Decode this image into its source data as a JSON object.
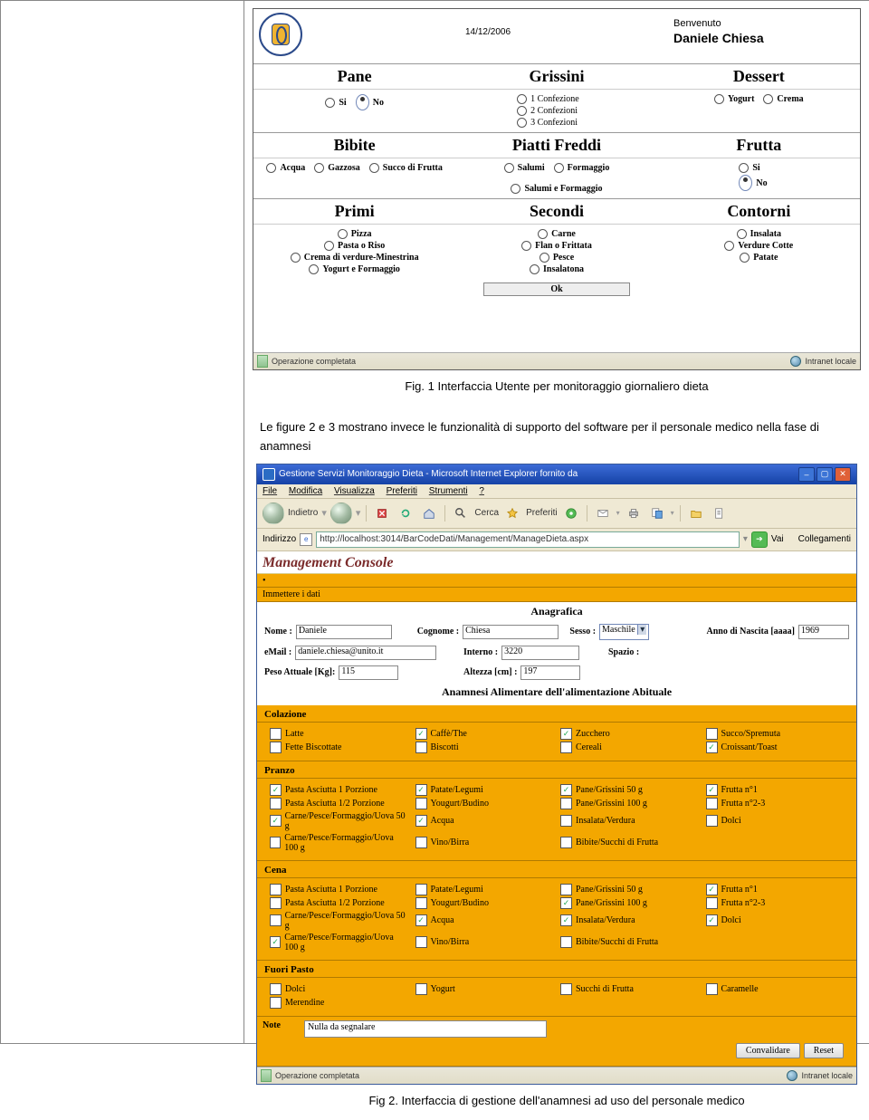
{
  "caption1": "Fig. 1 Interfaccia Utente per monitoraggio giornaliero dieta",
  "body_text": "Le figure 2 e 3 mostrano invece le funzionalità di supporto del software per il personale medico nella fase di anamnesi",
  "caption2": "Fig 2. Interfaccia di gestione dell'anamnesi ad uso del personale medico",
  "fig1": {
    "date": "14/12/2006",
    "welcome": "Benvenuto",
    "user": "Daniele Chiesa",
    "status_left": "Operazione completata",
    "status_right": "Intranet locale",
    "ok": "Ok",
    "sections": {
      "pane": {
        "title": "Pane",
        "opts": [
          "Si",
          "No"
        ],
        "selected": "No",
        "layout": "inline"
      },
      "grissini": {
        "title": "Grissini",
        "opts": [
          "1 Confezione",
          "2 Confezioni",
          "3 Confezioni"
        ],
        "layout": "stack"
      },
      "dessert": {
        "title": "Dessert",
        "opts": [
          "Yogurt",
          "Crema"
        ],
        "layout": "inline"
      },
      "bibite": {
        "title": "Bibite",
        "opts": [
          "Acqua",
          "Gazzosa",
          "Succo di Frutta"
        ],
        "layout": "inline"
      },
      "piatti": {
        "title": "Piatti Freddi",
        "opts": [
          "Salumi",
          "Formaggio",
          "Salumi e Formaggio"
        ],
        "layout": "inline"
      },
      "frutta": {
        "title": "Frutta",
        "opts": [
          "Si",
          "No"
        ],
        "selected": "No",
        "layout": "stack"
      },
      "primi": {
        "title": "Primi",
        "opts": [
          "Pizza",
          "Pasta o Riso",
          "Crema di verdure-Minestrina",
          "Yogurt e Formaggio"
        ],
        "layout": "stack"
      },
      "secondi": {
        "title": "Secondi",
        "opts": [
          "Carne",
          "Flan o Frittata",
          "Pesce",
          "Insalatona"
        ],
        "layout": "stack"
      },
      "contorni": {
        "title": "Contorni",
        "opts": [
          "Insalata",
          "Verdure Cotte",
          "Patate"
        ],
        "layout": "stack"
      }
    }
  },
  "fig2": {
    "window_title": "Gestione Servizi Monitoraggio Dieta - Microsoft Internet Explorer fornito da",
    "menu": [
      "File",
      "Modifica",
      "Visualizza",
      "Preferiti",
      "Strumenti",
      "?"
    ],
    "toolbar": {
      "back": "Indietro",
      "search": "Cerca",
      "fav": "Preferiti"
    },
    "address_label": "Indirizzo",
    "address_value": "http://localhost:3014/BarCodeDati/Management/ManageDieta.aspx",
    "go": "Vai",
    "links": "Collegamenti",
    "mc_title": "Management Console",
    "insert_label": "Immettere i dati",
    "status_left": "Operazione completata",
    "status_right": "Intranet locale",
    "section_anagrafica": "Anagrafica",
    "section_anamnesi": "Anamnesi Alimentare dell'alimentazione Abituale",
    "fields": {
      "nome": {
        "label": "Nome :",
        "value": "Daniele"
      },
      "cognome": {
        "label": "Cognome :",
        "value": "Chiesa"
      },
      "sesso": {
        "label": "Sesso :",
        "value": "Maschile"
      },
      "anno": {
        "label": "Anno di Nascita [aaaa]",
        "value": "1969"
      },
      "email": {
        "label": "eMail :",
        "value": "daniele.chiesa@unito.it"
      },
      "interno": {
        "label": "Interno :",
        "value": "3220"
      },
      "spazio": {
        "label": "Spazio :",
        "value": ""
      },
      "peso": {
        "label": "Peso Attuale [Kg]:",
        "value": "115"
      },
      "altezza": {
        "label": "Altezza [cm] :",
        "value": "197"
      }
    },
    "meals": {
      "colazione": {
        "title": "Colazione",
        "cols": [
          [
            [
              "Latte",
              false
            ],
            [
              "Fette Biscottate",
              false
            ]
          ],
          [
            [
              "Caffè/The",
              true
            ],
            [
              "Biscotti",
              false
            ]
          ],
          [
            [
              "Zucchero",
              true
            ],
            [
              "Cereali",
              false
            ]
          ],
          [
            [
              "Succo/Spremuta",
              false
            ],
            [
              "Croissant/Toast",
              true
            ]
          ]
        ]
      },
      "pranzo": {
        "title": "Pranzo",
        "cols": [
          [
            [
              "Pasta Asciutta 1 Porzione",
              true
            ],
            [
              "Pasta Asciutta 1/2 Porzione",
              false
            ],
            [
              "Carne/Pesce/Formaggio/Uova 50 g",
              true
            ],
            [
              "Carne/Pesce/Formaggio/Uova 100 g",
              false
            ]
          ],
          [
            [
              "Patate/Legumi",
              true
            ],
            [
              "Yougurt/Budino",
              false
            ],
            [
              "Acqua",
              true
            ],
            [
              "Vino/Birra",
              false
            ]
          ],
          [
            [
              "Pane/Grissini 50 g",
              true
            ],
            [
              "Pane/Grissini 100 g",
              false
            ],
            [
              "Insalata/Verdura",
              false
            ],
            [
              "Bibite/Succhi di Frutta",
              false
            ]
          ],
          [
            [
              "Frutta n°1",
              true
            ],
            [
              "Frutta n°2-3",
              false
            ],
            [
              "Dolci",
              false
            ]
          ]
        ]
      },
      "cena": {
        "title": "Cena",
        "cols": [
          [
            [
              "Pasta Asciutta 1 Porzione",
              false
            ],
            [
              "Pasta Asciutta 1/2 Porzione",
              false
            ],
            [
              "Carne/Pesce/Formaggio/Uova 50 g",
              false
            ],
            [
              "Carne/Pesce/Formaggio/Uova 100 g",
              true
            ]
          ],
          [
            [
              "Patate/Legumi",
              false
            ],
            [
              "Yougurt/Budino",
              false
            ],
            [
              "Acqua",
              true
            ],
            [
              "Vino/Birra",
              false
            ]
          ],
          [
            [
              "Pane/Grissini 50 g",
              false
            ],
            [
              "Pane/Grissini 100 g",
              true
            ],
            [
              "Insalata/Verdura",
              true
            ],
            [
              "Bibite/Succhi di Frutta",
              false
            ]
          ],
          [
            [
              "Frutta n°1",
              true
            ],
            [
              "Frutta n°2-3",
              false
            ],
            [
              "Dolci",
              true
            ]
          ]
        ]
      },
      "fuori": {
        "title": "Fuori Pasto",
        "cols": [
          [
            [
              "Dolci",
              false
            ],
            [
              "Merendine",
              false
            ]
          ],
          [
            [
              "Yogurt",
              false
            ]
          ],
          [
            [
              "Succhi di Frutta",
              false
            ]
          ],
          [
            [
              "Caramelle",
              false
            ]
          ]
        ]
      }
    },
    "note": {
      "label": "Note",
      "value": "Nulla da segnalare"
    },
    "buttons": {
      "validate": "Convalidare",
      "reset": "Reset"
    }
  }
}
